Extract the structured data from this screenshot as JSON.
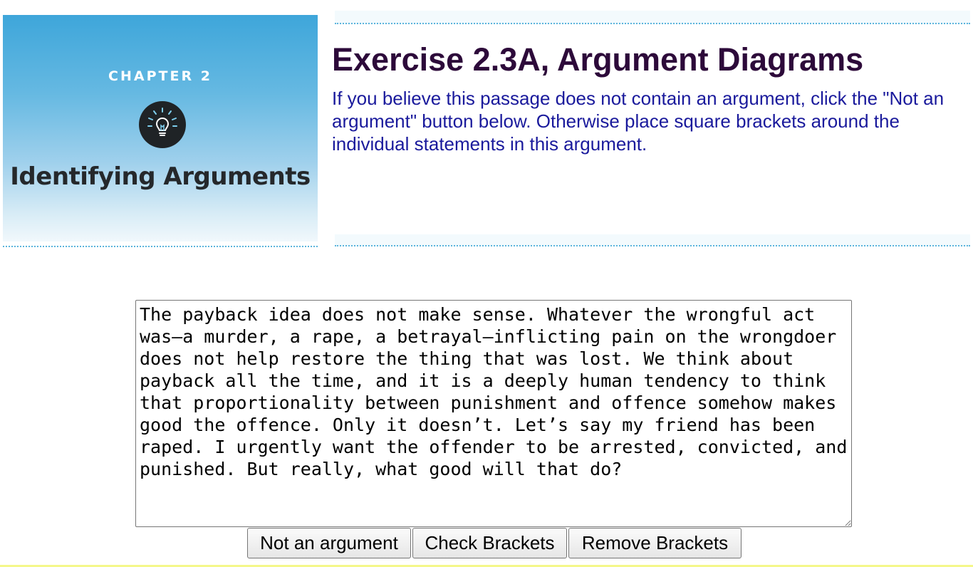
{
  "banner": {
    "chapter_label": "CHAPTER 2",
    "icon": "lightbulb-icon",
    "title": "Identifying Arguments"
  },
  "header": {
    "title": "Exercise 2.3A, Argument Diagrams",
    "instructions": "If you believe this passage does not contain an argument, click the \"Not an argument\" button below. Otherwise place square brackets around the individual statements in this argument."
  },
  "passage": {
    "text": "The payback idea does not make sense. Whatever the wrongful act was—a murder, a rape, a betrayal—inflicting pain on the wrongdoer does not help restore the thing that was lost. We think about payback all the time, and it is a deeply human tendency to think that proportionality between punishment and offence somehow makes good the offence. Only it doesn’t. Let’s say my friend has been raped. I urgently want the offender to be arrested, convicted, and punished. But really, what good will that do?"
  },
  "buttons": {
    "not_argument": "Not an argument",
    "check_brackets": "Check Brackets",
    "remove_brackets": "Remove Brackets"
  },
  "colors": {
    "banner_blue": "#3ea6da",
    "title_purple": "#2d0a3a",
    "instructions_blue": "#1a1a9c",
    "dotted_rule": "#5bb4dc"
  }
}
